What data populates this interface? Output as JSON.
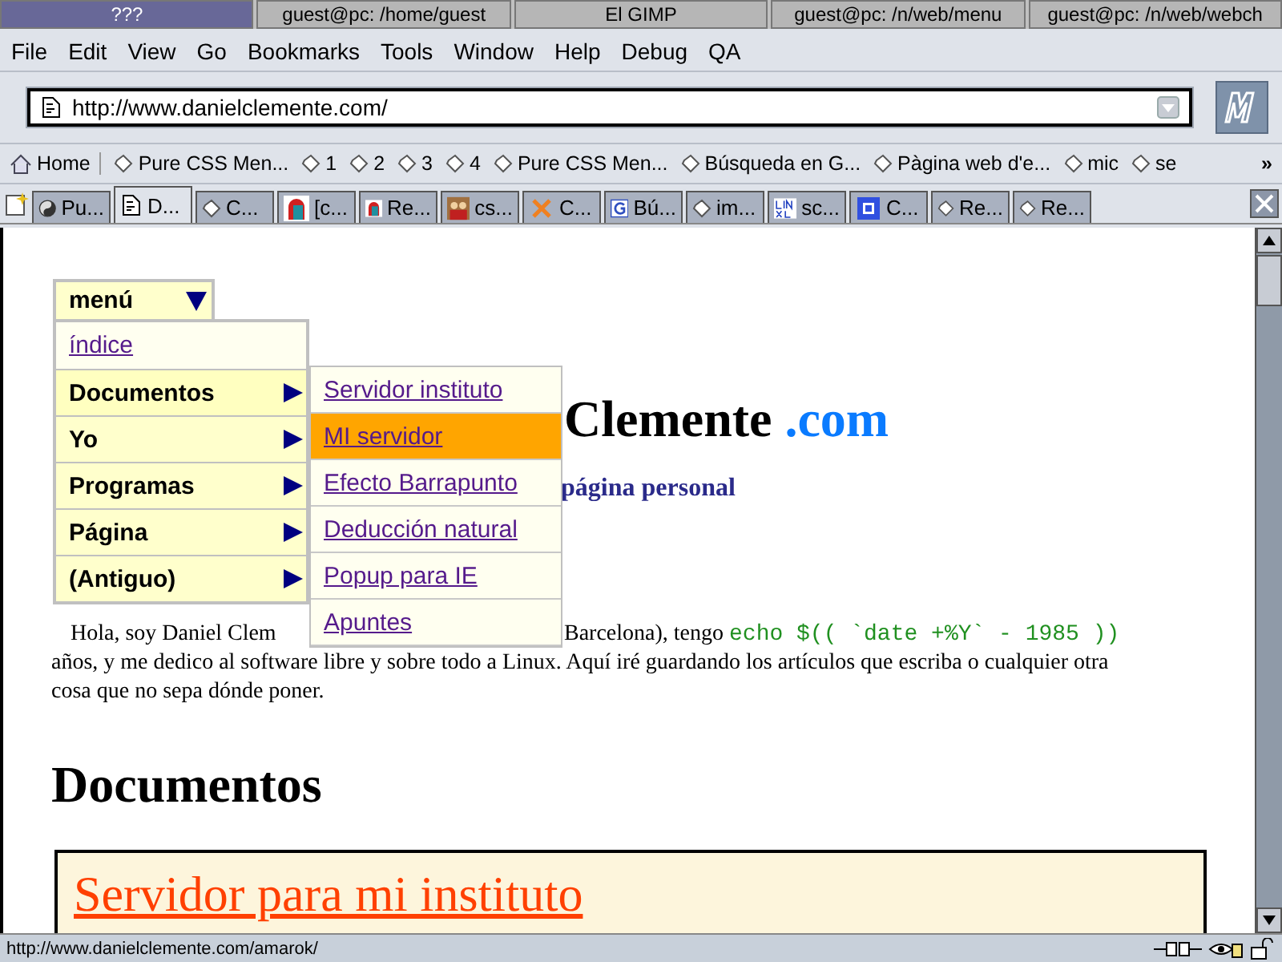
{
  "taskbar": [
    {
      "label": "???",
      "selected": true
    },
    {
      "label": "guest@pc: /home/guest",
      "selected": false
    },
    {
      "label": "El GIMP",
      "selected": false
    },
    {
      "label": "guest@pc: /n/web/menu",
      "selected": false
    },
    {
      "label": "guest@pc: /n/web/webch",
      "selected": false
    }
  ],
  "menubar": [
    "File",
    "Edit",
    "View",
    "Go",
    "Bookmarks",
    "Tools",
    "Window",
    "Help",
    "Debug",
    "QA"
  ],
  "url": "http://www.danielclemente.com/",
  "bookmarks": [
    {
      "kind": "home",
      "label": "Home"
    },
    {
      "kind": "bookmark",
      "label": "Pure CSS Men..."
    },
    {
      "kind": "bookmark",
      "label": "1"
    },
    {
      "kind": "bookmark",
      "label": "2"
    },
    {
      "kind": "bookmark",
      "label": "3"
    },
    {
      "kind": "bookmark",
      "label": "4"
    },
    {
      "kind": "bookmark",
      "label": "Pure CSS Men..."
    },
    {
      "kind": "bookmark",
      "label": "Búsqueda en G..."
    },
    {
      "kind": "bookmark",
      "label": "Pàgina web d'e..."
    },
    {
      "kind": "bookmark",
      "label": "mic"
    },
    {
      "kind": "bookmark",
      "label": "se"
    }
  ],
  "bookmarks_more": "»",
  "tabs": [
    {
      "kind": "yinyang",
      "label": "Pu...",
      "selected": false
    },
    {
      "kind": "site",
      "label": "D...",
      "selected": true
    },
    {
      "kind": "bookmark",
      "label": "C...",
      "selected": false
    },
    {
      "kind": "face",
      "label": "[c...",
      "selected": false
    },
    {
      "kind": "face",
      "label": "Re...",
      "selected": false
    },
    {
      "kind": "people",
      "label": "cs...",
      "selected": false
    },
    {
      "kind": "star",
      "label": "C...",
      "selected": false
    },
    {
      "kind": "letter",
      "label": "Bú...",
      "selected": false
    },
    {
      "kind": "bookmark",
      "label": "im...",
      "selected": false
    },
    {
      "kind": "grid",
      "label": "sc...",
      "selected": false
    },
    {
      "kind": "blue",
      "label": "C...",
      "selected": false
    },
    {
      "kind": "bookmark",
      "label": "Re...",
      "selected": false
    },
    {
      "kind": "bookmark",
      "label": "Re...",
      "selected": false
    }
  ],
  "page": {
    "heading": "Clemente",
    "heading_suffix": ".com",
    "subtitle": "página personal",
    "intro_left": "Hola, soy Daniel Clem",
    "intro_right": "Barcelona), tengo",
    "intro_code": "echo $(( `date +%Y` - 1985 ))",
    "intro_rest": "años, y me dedico al software libre y sobre todo a Linux. Aquí iré guardando los artículos que escriba o cualquier otra cosa que no sepa dónde poner.",
    "section": "Documentos",
    "card_link": "Servidor para mi instituto"
  },
  "menu": {
    "title": "menú",
    "items": [
      {
        "label": "índice",
        "kind": "link"
      },
      {
        "label": "Documentos",
        "kind": "submenu",
        "expanded": true
      },
      {
        "label": "Yo",
        "kind": "submenu",
        "expanded": false
      },
      {
        "label": "Programas",
        "kind": "submenu",
        "expanded": false
      },
      {
        "label": "Página",
        "kind": "submenu",
        "expanded": false
      },
      {
        "label": "(Antiguo)",
        "kind": "submenu",
        "expanded": false
      }
    ],
    "submenu": [
      {
        "label": "Servidor instituto",
        "selected": false
      },
      {
        "label": "MI servidor",
        "selected": true
      },
      {
        "label": "Efecto Barrapunto",
        "selected": false
      },
      {
        "label": "Deducción natural",
        "selected": false
      },
      {
        "label": "Popup para IE",
        "selected": false
      },
      {
        "label": "Apuntes",
        "selected": false
      }
    ]
  },
  "status_bar": "http://www.danielclemente.com/amarok/"
}
